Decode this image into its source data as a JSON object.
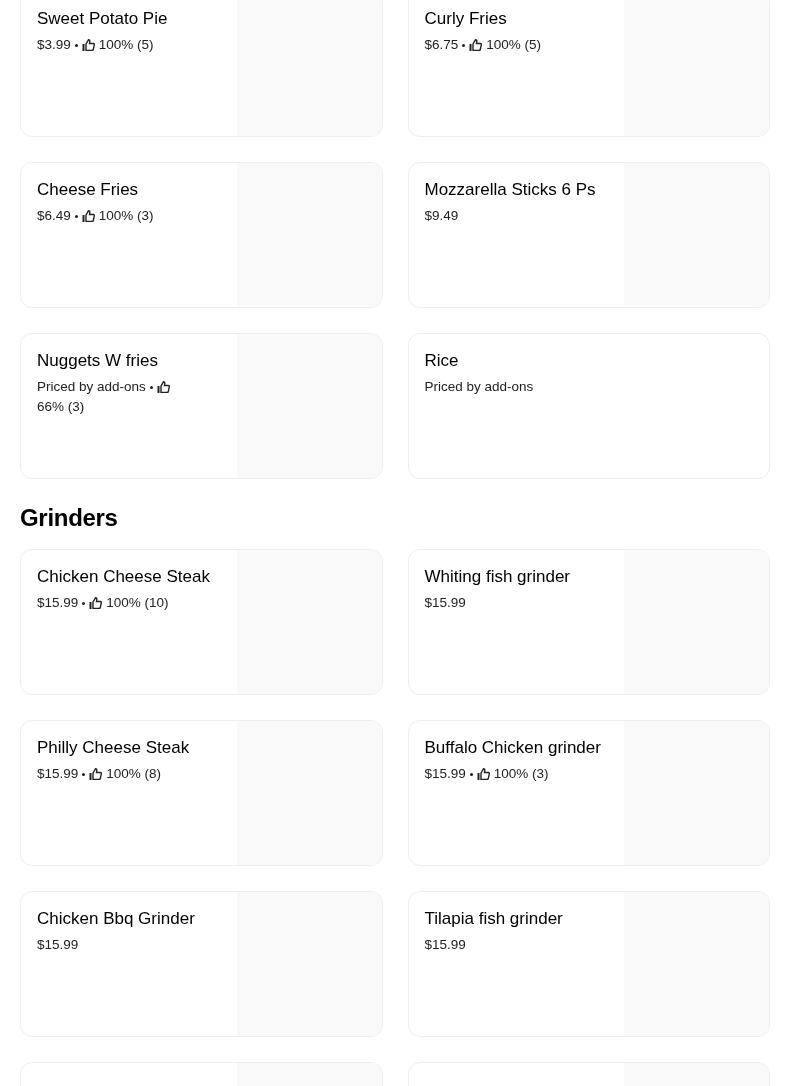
{
  "sections": [
    {
      "items": [
        {
          "kind": "item",
          "name": "Sweet Potato Pie",
          "price": "$3.99",
          "rating": "100% (5)",
          "image": true
        },
        {
          "kind": "item",
          "name": "Curly Fries",
          "price": "$6.75",
          "rating": "100% (5)",
          "image": true
        },
        {
          "kind": "item",
          "name": "Cheese Fries",
          "price": "$6.49",
          "rating": "100% (3)",
          "image": true
        },
        {
          "kind": "item",
          "name": "Mozzarella Sticks 6 Ps",
          "price": "$9.49",
          "image": true
        },
        {
          "kind": "item",
          "name": "Nuggets W fries",
          "price": "Priced by add-ons",
          "rating": "66% (3)",
          "image": true
        },
        {
          "kind": "item",
          "name": "Rice",
          "price": "Priced by add-ons",
          "image": false
        }
      ]
    },
    {
      "title": "Grinders",
      "items": [
        {
          "kind": "item",
          "name": "Chicken Cheese Steak",
          "price": "$15.99",
          "rating": "100% (10)",
          "image": true
        },
        {
          "kind": "item",
          "name": "Whiting fish grinder",
          "price": "$15.99",
          "image": true
        },
        {
          "kind": "item",
          "name": "Philly Cheese Steak",
          "price": "$15.99",
          "rating": "100% (8)",
          "image": true
        },
        {
          "kind": "item",
          "name": "Buffalo Chicken grinder",
          "price": "$15.99",
          "rating": "100% (3)",
          "image": true
        },
        {
          "kind": "item",
          "name": "Chicken Bbq Grinder",
          "price": "$15.99",
          "image": true
        },
        {
          "kind": "item",
          "name": "Tilapia fish grinder",
          "price": "$15.99",
          "image": true
        },
        {
          "kind": "cut",
          "image": true
        },
        {
          "kind": "cut",
          "image": true
        }
      ]
    }
  ]
}
